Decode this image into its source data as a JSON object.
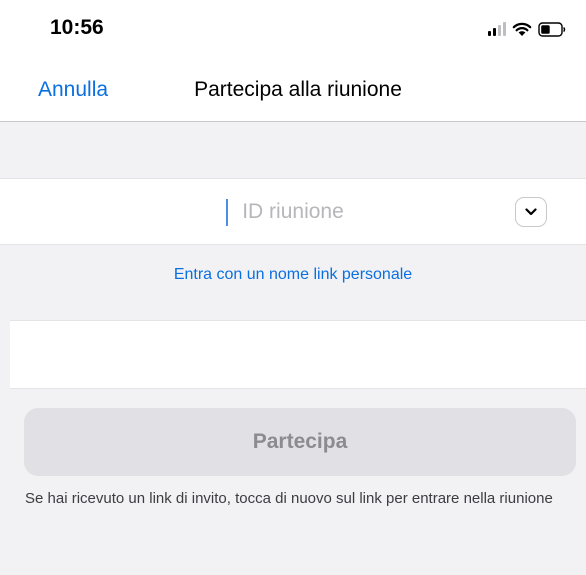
{
  "status_bar": {
    "time": "10:56"
  },
  "nav": {
    "cancel_label": "Annulla",
    "title": "Partecipa alla riunione"
  },
  "meeting_id": {
    "value": "",
    "placeholder": "ID riunione"
  },
  "personal_link_label": "Entra con un nome link personale",
  "join_button_label": "Partecipa",
  "hint_text": "Se hai ricevuto un link di invito, tocca di nuovo sul link per entrare nella riunione",
  "colors": {
    "accent": "#0a6fe0",
    "background": "#f2f2f4",
    "button_disabled_bg": "#e1e1e5",
    "button_disabled_text": "#8b8b90"
  },
  "icons": [
    "cellular-signal-icon",
    "wifi-icon",
    "battery-icon",
    "chevron-down-icon"
  ]
}
